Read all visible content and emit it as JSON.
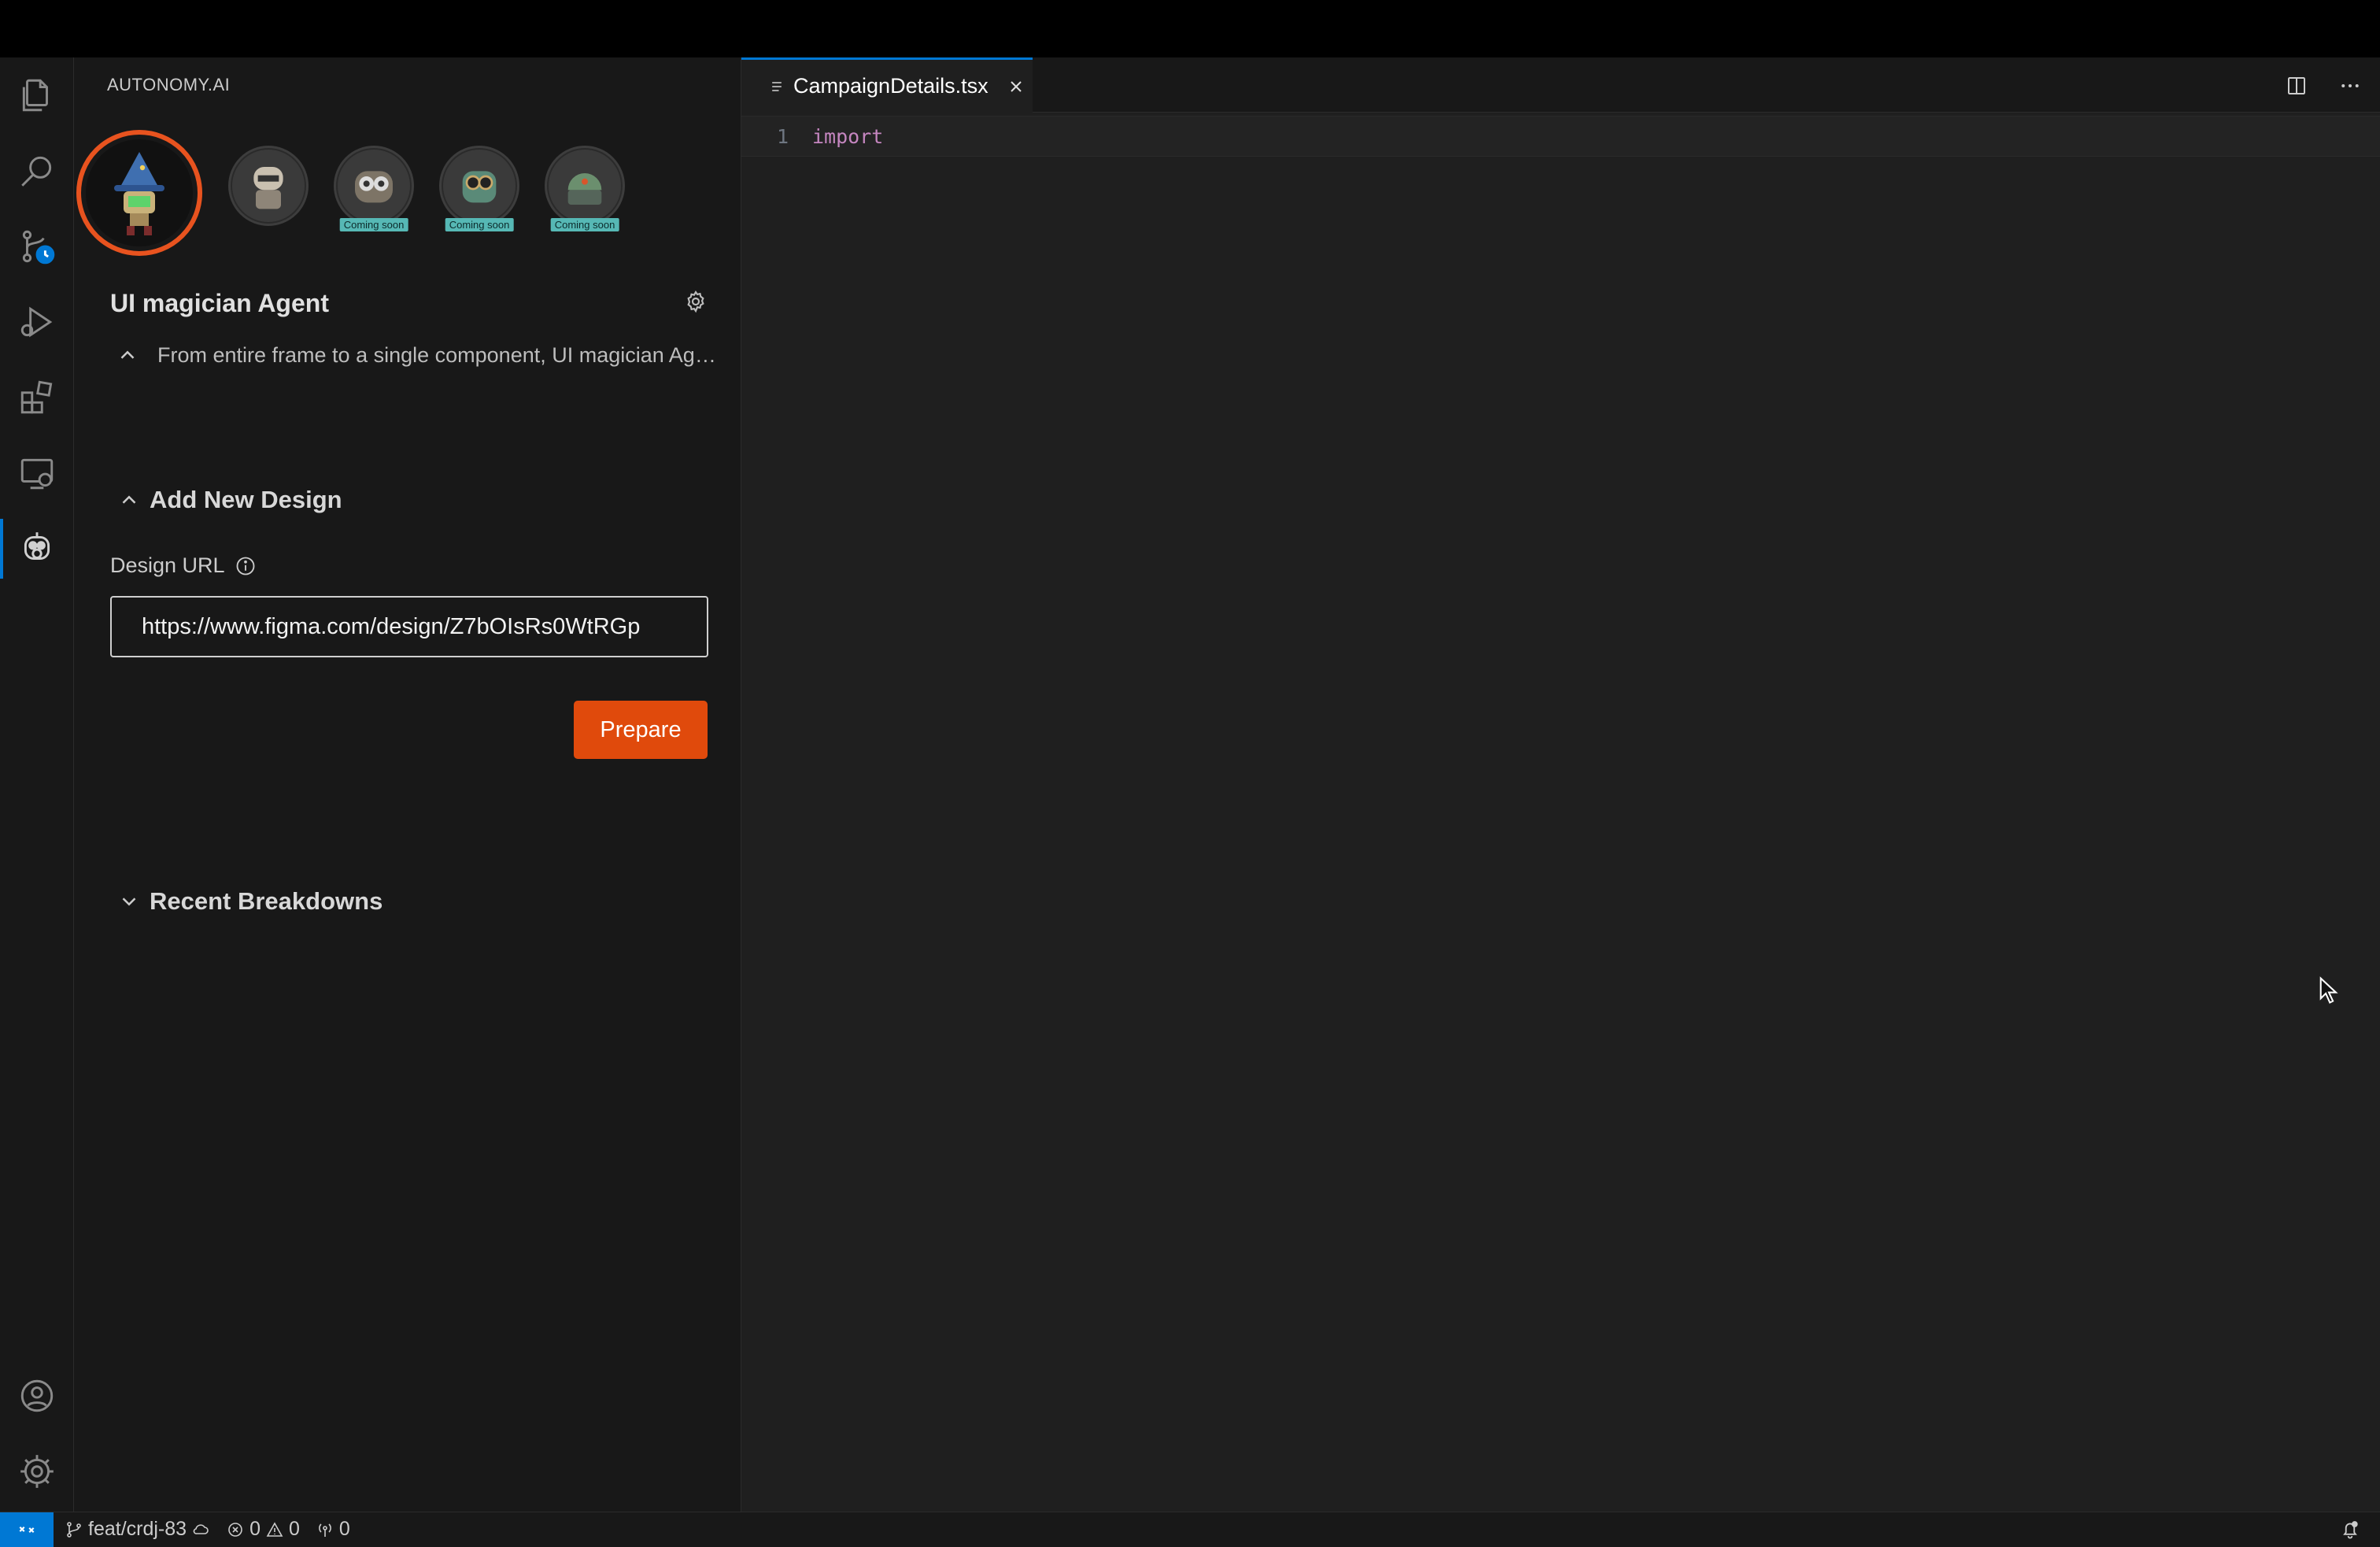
{
  "sidebar": {
    "title": "AUTONOMY.AI",
    "agents": [
      {
        "name": "ui-magician-agent",
        "badge": ""
      },
      {
        "name": "agent-2",
        "badge": ""
      },
      {
        "name": "agent-3",
        "badge": "Coming soon"
      },
      {
        "name": "agent-4",
        "badge": "Coming soon"
      },
      {
        "name": "agent-5",
        "badge": "Coming soon"
      }
    ],
    "agent_title": "UI magician Agent",
    "agent_description": "From entire frame to a single component, UI magician Agent turns designs into code",
    "add_design": {
      "heading": "Add New Design",
      "url_label": "Design URL",
      "url_value": "https://www.figma.com/design/Z7bOIsRs0WtRGp",
      "prepare_label": "Prepare"
    },
    "recent_heading": "Recent Breakdowns"
  },
  "editor": {
    "tab_name": "CampaignDetails.tsx",
    "lines": [
      {
        "number": "1",
        "code": "import"
      }
    ]
  },
  "statusbar": {
    "branch": "feat/crdj-83",
    "errors": "0",
    "warnings": "0",
    "ports": "0"
  },
  "colors": {
    "accent": "#0078d4",
    "brand_orange": "#e04a0c",
    "badge_teal": "#56b8b5"
  }
}
